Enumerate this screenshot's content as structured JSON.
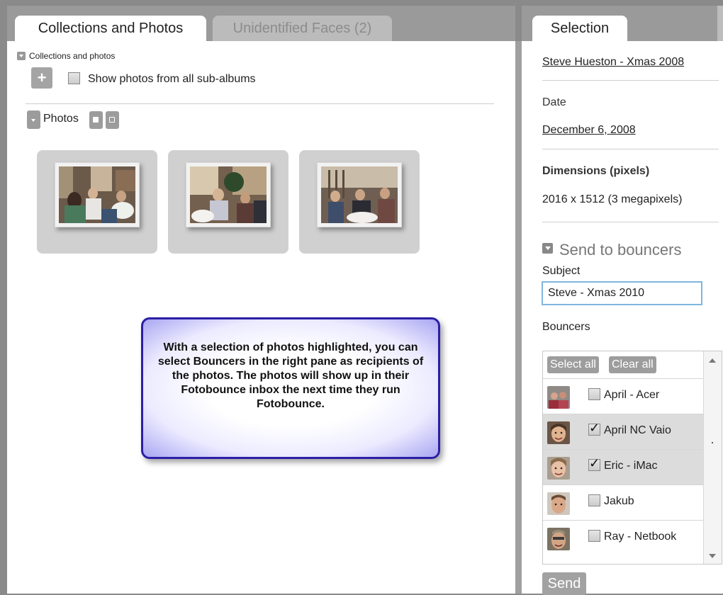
{
  "tabs": {
    "collections": "Collections and Photos",
    "unidentified": "Unidentified Faces (2)",
    "selection": "Selection"
  },
  "collections": {
    "header": "Collections and photos",
    "show_sub_albums_label": "Show photos from all sub-albums",
    "show_sub_albums_checked": false
  },
  "photos": {
    "label": "Photos",
    "count": 3
  },
  "callout": {
    "text": "With a selection of photos highlighted, you can select Bouncers in the right pane as recipients of the photos.  The photos will show up in their Fotobounce inbox the next time they run Fotobounce."
  },
  "selection": {
    "album_link": "Steve Hueston - Xmas 2008",
    "date_label": "Date",
    "date_value": "December 6, 2008",
    "dimensions_label": "Dimensions (pixels)",
    "dimensions_value": "2016 x 1512 (3 megapixels)",
    "send_section_title": "Send to bouncers",
    "subject_label": "Subject",
    "subject_value": "Steve - Xmas 2010",
    "bouncers_label": "Bouncers",
    "select_all": "Select all",
    "clear_all": "Clear all",
    "bouncers": [
      {
        "name": "April - Acer",
        "checked": false
      },
      {
        "name": "April NC Vaio",
        "checked": true
      },
      {
        "name": "Eric - iMac",
        "checked": true
      },
      {
        "name": "Jakub",
        "checked": false
      },
      {
        "name": "Ray - Netbook",
        "checked": false
      }
    ],
    "send_label": "Send"
  }
}
